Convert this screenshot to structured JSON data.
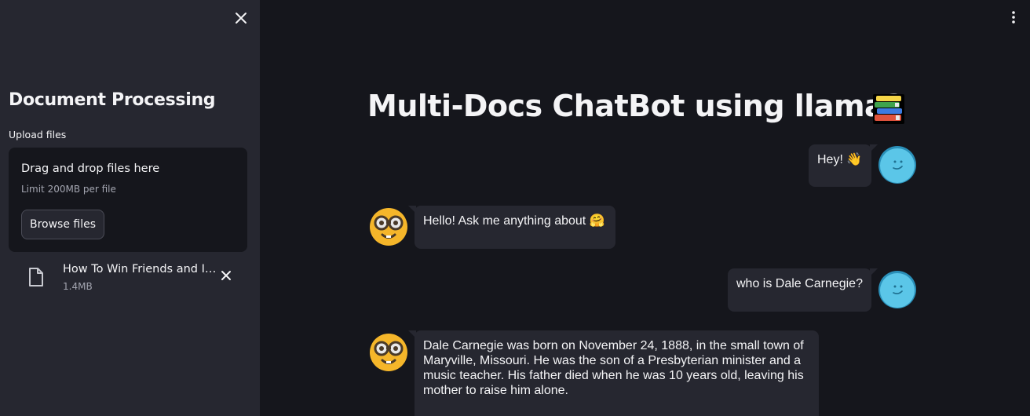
{
  "sidebar": {
    "title": "Document Processing",
    "upload_label": "Upload files",
    "dropzone": {
      "title": "Drag and drop files here",
      "limit": "Limit 200MB per file",
      "browse_label": "Browse files"
    },
    "file": {
      "name": "How To Win Friends and Influence People.pdf",
      "size": "1.4MB"
    },
    "icons": {
      "close": "close-icon",
      "file": "file-icon",
      "remove": "close-icon"
    }
  },
  "main": {
    "title": "Multi-Docs ChatBot using llama2",
    "title_icon": "books-icon",
    "menu_icon": "kebab-menu-icon",
    "messages": [
      {
        "role": "user",
        "text": "Hey! 👋",
        "avatar": "smiley-blue-icon"
      },
      {
        "role": "assistant",
        "text": "Hello! Ask me anything about 🤗",
        "avatar": "nerd-face-icon"
      },
      {
        "role": "user",
        "text": "who is Dale Carnegie?",
        "avatar": "smiley-blue-icon"
      },
      {
        "role": "assistant",
        "text": "Dale Carnegie was born on November 24, 1888, in the small town of Maryville, Missouri. He was the son of a Presbyterian minister and a music teacher. His father died when he was 10 years old, leaving his mother to raise him alone.",
        "avatar": "nerd-face-icon"
      }
    ]
  },
  "colors": {
    "background": "#15161c",
    "sidebar": "#262730",
    "bubble": "#262730",
    "user_avatar": "#5bc6e8",
    "bot_avatar": "#f5b62a"
  }
}
